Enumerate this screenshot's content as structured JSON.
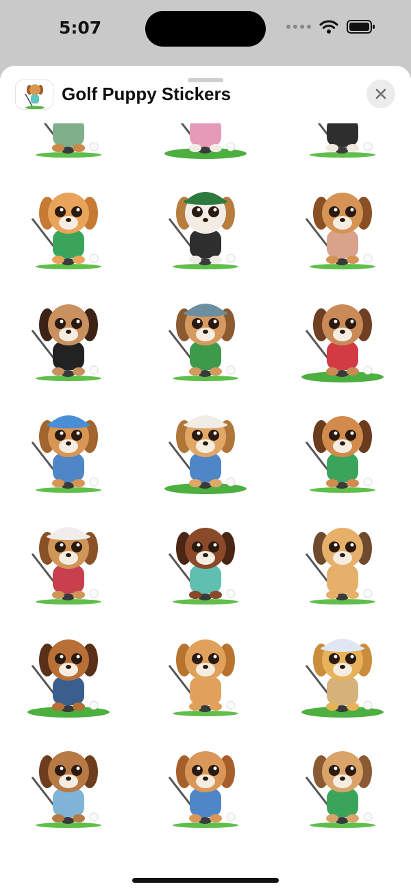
{
  "status_bar": {
    "time": "5:07",
    "signal_icon": "cellular-dots-icon",
    "wifi_icon": "wifi-icon",
    "battery_icon": "battery-icon"
  },
  "sheet": {
    "title": "Golf Puppy Stickers",
    "app_icon": "golf-puppy-app-icon",
    "close_icon": "close-icon"
  },
  "stickers": [
    {
      "fur": "#c98a4b",
      "ear": "#8a4a1e",
      "hat": "#52c3cf",
      "shirt": "#7fb08b",
      "base": false
    },
    {
      "fur": "#f1ede6",
      "ear": "#7a4a2a",
      "hat": "#ddd5c9",
      "shirt": "#e79ab8",
      "base": true
    },
    {
      "fur": "#f2e9de",
      "ear": "#c27a3c",
      "hat": "#5f7fbc",
      "shirt": "#2e2e2e",
      "base": false
    },
    {
      "fur": "#e8a45a",
      "ear": "#c77a33",
      "hat": "",
      "shirt": "#3aa55a",
      "base": false
    },
    {
      "fur": "#f1ece6",
      "ear": "#b77d3f",
      "hat": "#2e7a3e",
      "shirt": "#2e2e2e",
      "base": false
    },
    {
      "fur": "#d69356",
      "ear": "#8a4f24",
      "hat": "",
      "shirt": "#d8a38a",
      "base": false
    },
    {
      "fur": "#c99060",
      "ear": "#3b2416",
      "hat": "",
      "shirt": "#222222",
      "base": false
    },
    {
      "fur": "#d49a60",
      "ear": "#8c5a30",
      "hat": "#6b8fa0",
      "shirt": "#3d9a4a",
      "base": false
    },
    {
      "fur": "#c98a57",
      "ear": "#6e3f22",
      "hat": "",
      "shirt": "#d23a44",
      "base": true
    },
    {
      "fur": "#d89553",
      "ear": "#a2652d",
      "hat": "#4a8ed6",
      "shirt": "#4f86c7",
      "base": false
    },
    {
      "fur": "#e0a766",
      "ear": "#b07638",
      "hat": "#f0ece6",
      "shirt": "#4f86c7",
      "base": true
    },
    {
      "fur": "#d28b4d",
      "ear": "#6b3b1e",
      "hat": "",
      "shirt": "#3aa55a",
      "base": false
    },
    {
      "fur": "#cf9658",
      "ear": "#8a5126",
      "hat": "#f0eeea",
      "shirt": "#c8404e",
      "base": false
    },
    {
      "fur": "#8a4a2a",
      "ear": "#4a2614",
      "hat": "",
      "shirt": "#5fbfb0",
      "base": false
    },
    {
      "fur": "#e6b06b",
      "ear": "#6e4a2e",
      "hat": "",
      "shirt": "#e6b06b",
      "base": false
    },
    {
      "fur": "#b87037",
      "ear": "#5a3018",
      "hat": "",
      "shirt": "#3a5f8f",
      "base": true
    },
    {
      "fur": "#e0a15c",
      "ear": "#b8742f",
      "hat": "",
      "shirt": "#e0a15c",
      "base": false
    },
    {
      "fur": "#e7b25a",
      "ear": "#c98d3b",
      "hat": "#dfe7f2",
      "shirt": "#d4b27a",
      "base": true
    },
    {
      "fur": "#b87a45",
      "ear": "#6e3d1d",
      "hat": "",
      "shirt": "#7fb4d8",
      "base": false
    },
    {
      "fur": "#d9975a",
      "ear": "#a65f2b",
      "hat": "",
      "shirt": "#4f86c7",
      "base": false
    },
    {
      "fur": "#d9a36a",
      "ear": "#8a5a32",
      "hat": "",
      "shirt": "#3aa55a",
      "base": false
    }
  ]
}
